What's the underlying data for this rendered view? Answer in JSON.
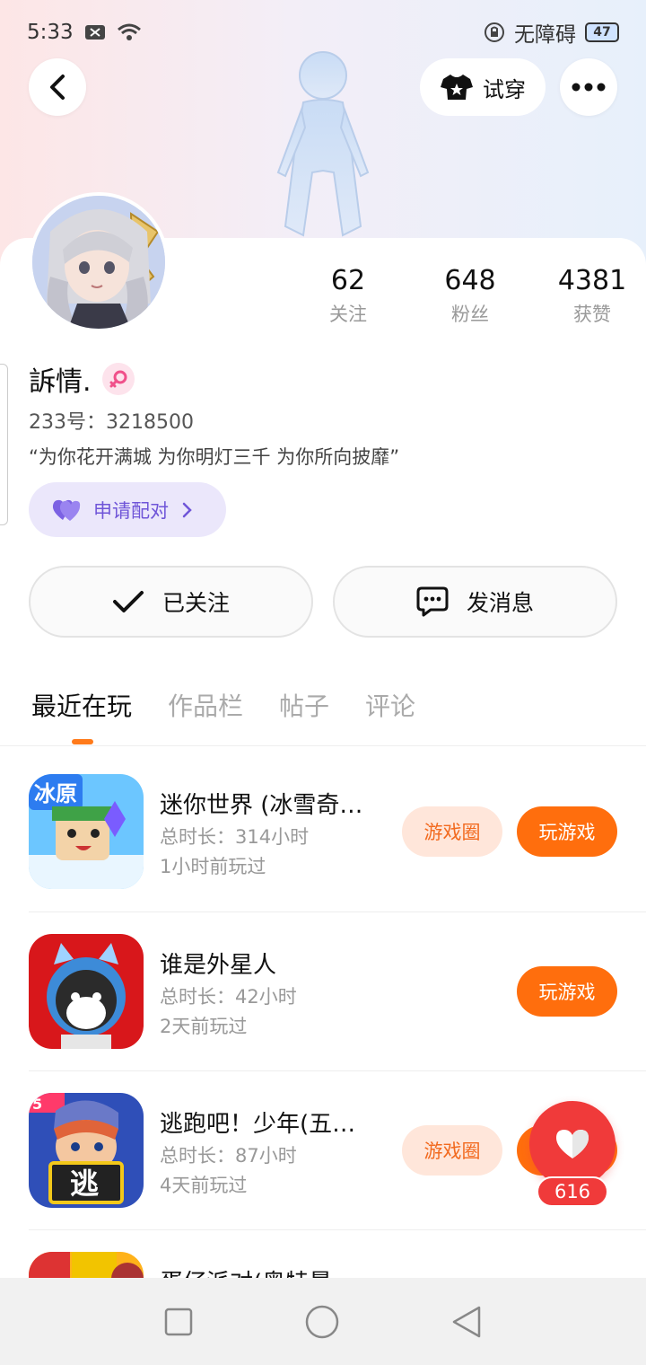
{
  "status": {
    "time": "5:33",
    "accessibility_label": "无障碍",
    "battery": "47"
  },
  "header": {
    "tryon_label": "试穿"
  },
  "profile": {
    "name": "訴情.",
    "uid": "233号：3218500",
    "bio": "“为你花开满城 为你明灯三千  为你所向披靡”",
    "pair_label": "申请配对"
  },
  "stats": [
    {
      "value": "62",
      "label": "关注"
    },
    {
      "value": "648",
      "label": "粉丝"
    },
    {
      "value": "4381",
      "label": "获赞"
    }
  ],
  "actions": {
    "followed_label": "已关注",
    "message_label": "发消息"
  },
  "tabs": [
    "最近在玩",
    "作品栏",
    "帖子",
    "评论"
  ],
  "games": [
    {
      "title": "迷你世界 (冰雪奇…",
      "duration": "总时长：314小时",
      "last_played": "1小时前玩过",
      "circle_label": "游戏圈",
      "play_label": "玩游戏"
    },
    {
      "title": "谁是外星人",
      "duration": "总时长：42小时",
      "last_played": "2天前玩过",
      "play_label": "玩游戏"
    },
    {
      "title": "逃跑吧！少年(五…",
      "duration": "总时长：87小时",
      "last_played": "4天前玩过",
      "circle_label": "游戏圈",
      "play_label": "玩游戏"
    },
    {
      "title": "蛋仔派对(奥特曼…"
    }
  ],
  "like": {
    "count": "616"
  },
  "colors": {
    "accent": "#ff6e0d",
    "like": "#f03a3a",
    "pair": "#6f55d8"
  }
}
